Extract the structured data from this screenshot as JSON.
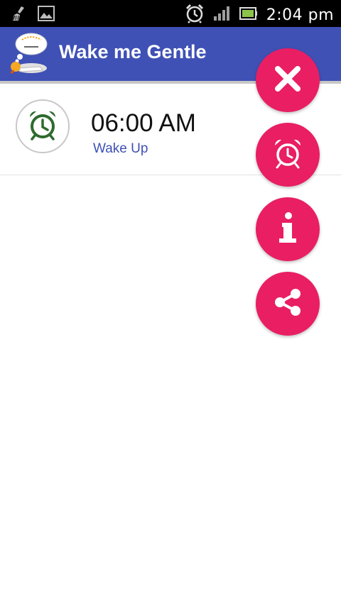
{
  "status_bar": {
    "time": "2:04 pm",
    "icons": [
      "broom-icon",
      "image-icon",
      "alarm-clock-icon",
      "signal-icon",
      "battery-icon"
    ]
  },
  "app_bar": {
    "title": "Wake me Gentle",
    "logo": "sleeping-character-logo"
  },
  "alarms": [
    {
      "time": "06:00 AM",
      "label": "Wake Up",
      "icon": "alarm-clock-icon"
    }
  ],
  "fab_menu": [
    {
      "name": "close",
      "icon": "close-icon"
    },
    {
      "name": "add-alarm",
      "icon": "alarm-clock-icon"
    },
    {
      "name": "info",
      "icon": "info-icon"
    },
    {
      "name": "share",
      "icon": "share-icon"
    }
  ],
  "colors": {
    "app_bar": "#3f51b5",
    "fab": "#e91e63",
    "alarm_icon": "#2e6b2e",
    "label": "#3f51b5"
  }
}
